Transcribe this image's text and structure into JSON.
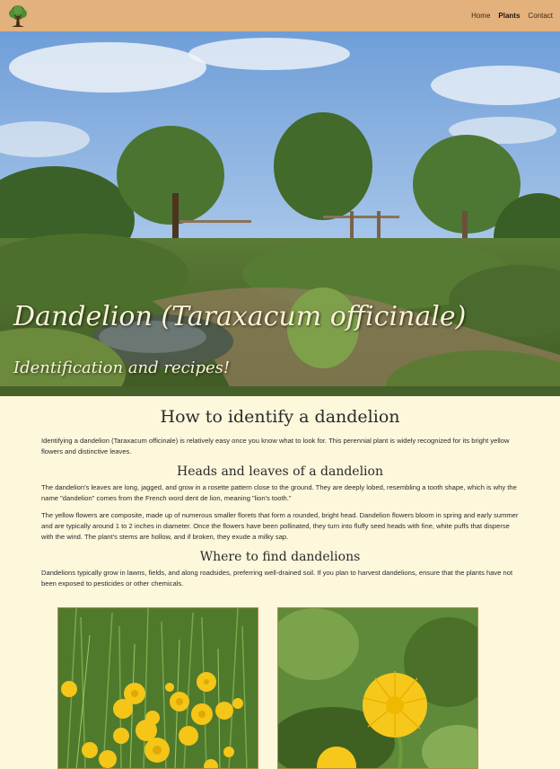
{
  "nav": {
    "logo_icon": "tree-logo-icon",
    "links": [
      {
        "label": "Home",
        "active": false
      },
      {
        "label": "Plants",
        "active": true
      },
      {
        "label": "Contact",
        "active": false
      }
    ]
  },
  "hero": {
    "title": "Dandelion (Taraxacum officinale)",
    "subtitle": "Identification and recipes!"
  },
  "sections": {
    "identify_heading": "How to identify a dandelion",
    "identify_text": "Identifying a dandelion (Taraxacum officinale) is relatively easy once you know what to look for. This perennial plant is widely recognized for its bright yellow flowers and distinctive leaves.",
    "heads_heading": "Heads and leaves of a dandelion",
    "heads_text_1": "The dandelion's leaves are long, jagged, and grow in a rosette pattern close to the ground. They are deeply lobed, resembling a tooth shape, which is why the name \"dandelion\" comes from the French word dent de lion, meaning \"lion's tooth.\"",
    "heads_text_2": "The yellow flowers are composite, made up of numerous smaller florets that form a rounded, bright head. Dandelion flowers bloom in spring and early summer and are typically around 1 to 2 inches in diameter. Once the flowers have been pollinated, they turn into fluffy seed heads with fine, white puffs that disperse with the wind. The plant's stems are hollow, and if broken, they exude a milky sap.",
    "where_heading": "Where to find dandelions",
    "where_text": "Dandelions typically grow in lawns, fields, and along roadsides, preferring well-drained soil. If you plan to harvest dandelions, ensure that the plants have not been exposed to pesticides or other chemicals."
  },
  "colors": {
    "navbar": "#e2b17c",
    "background": "#fdf7dc",
    "photo_border": "#b9864f",
    "dandelion_yellow": "#f5c518"
  }
}
